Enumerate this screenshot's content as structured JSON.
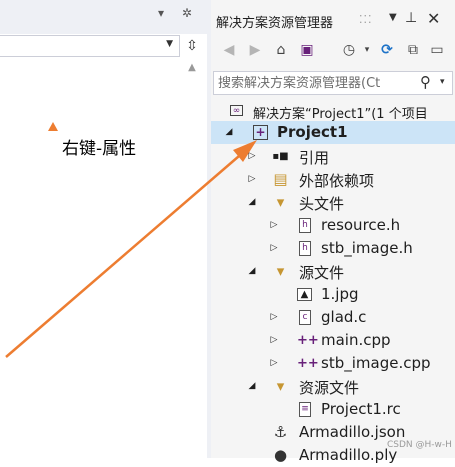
{
  "annotation": {
    "text": "右键-属性",
    "color": "#ed7d31"
  },
  "panel": {
    "title": "解决方案资源管理器",
    "search_placeholder": "搜索解决方案资源管理器(Ct",
    "toolbar_icons": [
      "back-icon",
      "forward-icon",
      "home-icon",
      "vs-switch-icon",
      "history-icon",
      "sync-icon",
      "collapse-all-icon"
    ]
  },
  "tree": {
    "solution_label": "解决方案“Project1”(1 个项目",
    "project_label": "Project1",
    "references": "引用",
    "external_deps": "外部依赖项",
    "header_files": "头文件",
    "resource_h": "resource.h",
    "stb_image_h": "stb_image.h",
    "source_files": "源文件",
    "jpg_1": "1.jpg",
    "glad_c": "glad.c",
    "main_cpp": "main.cpp",
    "stb_image_cpp": "stb_image.cpp",
    "resource_files": "资源文件",
    "project1_rc": "Project1.rc",
    "armadillo_json": "Armadillo.json",
    "armadillo_ply": "Armadillo.ply"
  },
  "watermark": "CSDN @H-w-H",
  "colors": {
    "selection": "#cce4f7",
    "accent_purple": "#68217a",
    "folder": "#c69632",
    "sync_blue": "#1e73c8"
  }
}
